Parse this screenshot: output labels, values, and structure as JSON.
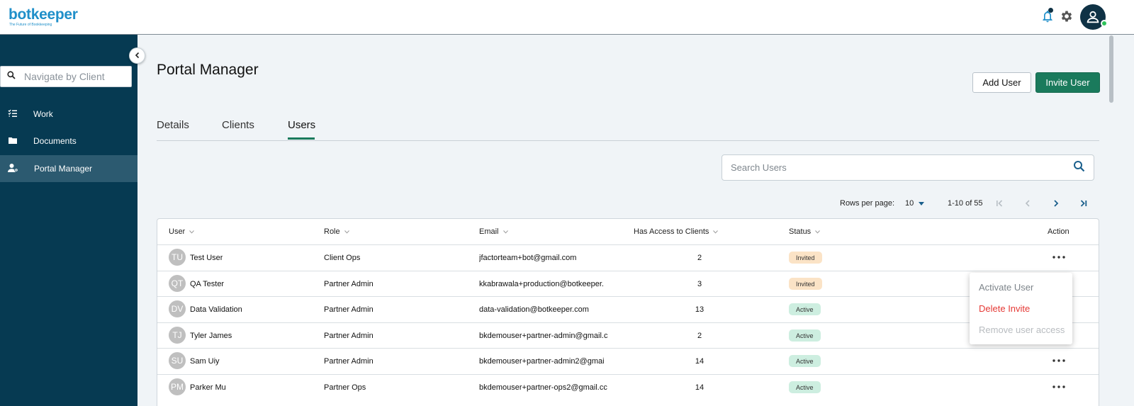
{
  "app": {
    "logo": "botkeeper",
    "logo_tagline": "The Future of Bookkeeping"
  },
  "topbar": {
    "icons": [
      "bell-icon",
      "gear-icon",
      "user-avatar-icon"
    ]
  },
  "sidebar": {
    "search_placeholder": "Navigate by Client",
    "items": [
      {
        "label": "Work",
        "icon": "checklist-icon",
        "active": false
      },
      {
        "label": "Documents",
        "icon": "folder-icon",
        "active": false
      },
      {
        "label": "Portal Manager",
        "icon": "user-gear-icon",
        "active": true
      }
    ]
  },
  "page": {
    "title": "Portal Manager",
    "add_user_label": "Add User",
    "invite_user_label": "Invite User",
    "tabs": [
      "Details",
      "Clients",
      "Users"
    ],
    "active_tab": "Users"
  },
  "search": {
    "placeholder": "Search Users"
  },
  "pagination": {
    "rows_per_page_label": "Rows per page:",
    "rows_per_page": "10",
    "range": "1-10 of 55"
  },
  "table": {
    "columns": [
      "User",
      "Role",
      "Email",
      "Has Access to Clients",
      "Status",
      "Action"
    ],
    "rows": [
      {
        "initials": "TU",
        "user": "Test User",
        "role": "Client Ops",
        "email": "jfactorteam+bot@gmail.com",
        "access": "2",
        "status": "Invited"
      },
      {
        "initials": "QT",
        "user": "QA Tester",
        "role": "Partner Admin",
        "email": "kkabrawala+production@botkeeper.",
        "access": "3",
        "status": "Invited"
      },
      {
        "initials": "DV",
        "user": "Data Validation",
        "role": "Partner Admin",
        "email": "data-validation@botkeeper.com",
        "access": "13",
        "status": "Active"
      },
      {
        "initials": "TJ",
        "user": "Tyler James",
        "role": "Partner Admin",
        "email": "bkdemouser+partner-admin@gmail.c",
        "access": "2",
        "status": "Active"
      },
      {
        "initials": "SU",
        "user": "Sam Uiy",
        "role": "Partner Admin",
        "email": "bkdemouser+partner-admin2@gmai",
        "access": "14",
        "status": "Active"
      },
      {
        "initials": "PM",
        "user": "Parker Mu",
        "role": "Partner Ops",
        "email": "bkdemouser+partner-ops2@gmail.cc",
        "access": "14",
        "status": "Active"
      }
    ]
  },
  "action_menu": {
    "items": [
      {
        "label": "Activate User",
        "state": "normal",
        "color": "#7d848a"
      },
      {
        "label": "Delete Invite",
        "state": "danger",
        "color": "#e53935"
      },
      {
        "label": "Remove user access",
        "state": "disabled",
        "color": "#b8bcc0"
      }
    ]
  },
  "colors": {
    "sidebar": "#063a52",
    "sidebar_active": "#2c5a70",
    "primary": "#1a7a5c",
    "invited_badge": "#fbe3c6",
    "active_badge": "#cdeee0"
  }
}
